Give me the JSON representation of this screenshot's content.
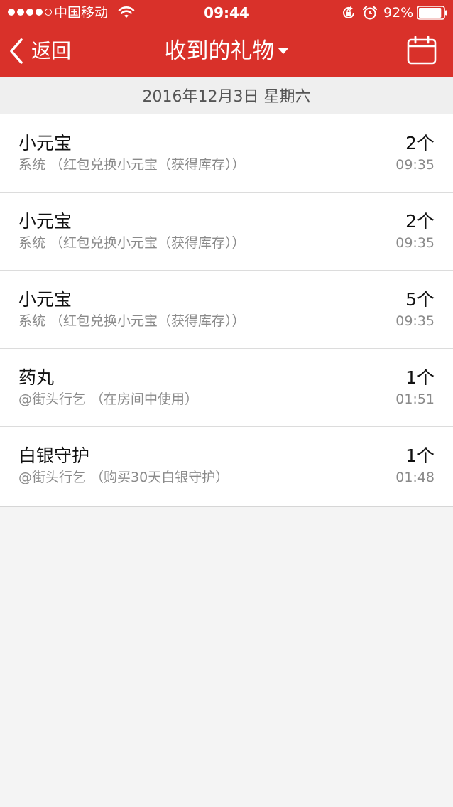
{
  "status_bar": {
    "carrier": "中国移动",
    "time": "09:44",
    "battery": "92%",
    "battery_level": 0.92,
    "signal_strength": 4,
    "signal_max": 5
  },
  "nav": {
    "back_label": "返回",
    "title": "收到的礼物",
    "accent_color": "#d9312a"
  },
  "date_header": "2016年12月3日 星期六",
  "gifts": [
    {
      "name": "小元宝",
      "source": "系统 （红包兑换小元宝（获得库存））",
      "count": "2个",
      "time": "09:35"
    },
    {
      "name": "小元宝",
      "source": "系统 （红包兑换小元宝（获得库存））",
      "count": "2个",
      "time": "09:35"
    },
    {
      "name": "小元宝",
      "source": "系统 （红包兑换小元宝（获得库存））",
      "count": "5个",
      "time": "09:35"
    },
    {
      "name": "药丸",
      "source": "@街头行乞 （在房间中使用）",
      "count": "1个",
      "time": "01:51"
    },
    {
      "name": "白银守护",
      "source": "@街头行乞 （购买30天白银守护）",
      "count": "1个",
      "time": "01:48"
    }
  ]
}
